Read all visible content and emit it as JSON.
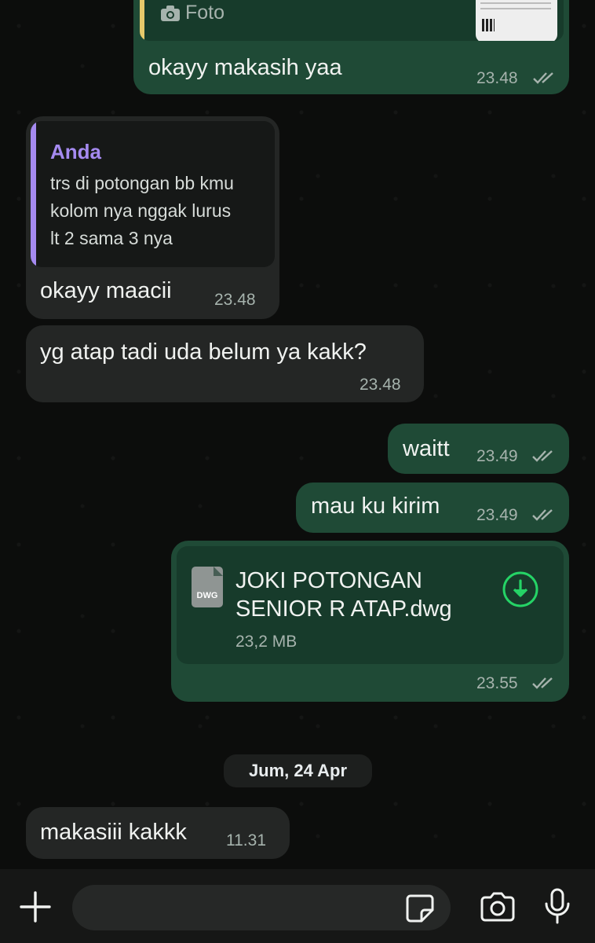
{
  "messages": {
    "m1": {
      "caption": "Foto",
      "text": "okayy makasih yaa",
      "time": "23.48"
    },
    "m2": {
      "quote_author": "Anda",
      "quote_lines": [
        "trs di potongan bb kmu",
        "kolom nya nggak lurus",
        "lt 2 sama 3 nya"
      ],
      "text": "okayy maacii",
      "time": "23.48"
    },
    "m3": {
      "text": "yg atap tadi uda belum ya kakk?",
      "time": "23.48"
    },
    "m4": {
      "text": "waitt",
      "time": "23.49"
    },
    "m5": {
      "text": "mau ku kirim",
      "time": "23.49"
    },
    "m6": {
      "file_type": "DWG",
      "file_name_lines": [
        "JOKI POTONGAN",
        "SENIOR R ATAP.dwg"
      ],
      "file_size": "23,2 MB",
      "time": "23.55"
    },
    "date_separator": "Jum, 24 Apr",
    "m7": {
      "text": "makasiii kakkk",
      "time": "11.31"
    }
  },
  "icons": {
    "attach": "plus-icon",
    "sticker": "sticker-icon",
    "camera": "camera-icon",
    "mic": "mic-icon",
    "read_receipt": "double-check-icon",
    "download": "download-icon",
    "photo": "camera-small-icon"
  },
  "colors": {
    "outgoing_bubble": "#1f4a36",
    "incoming_bubble": "#242625",
    "quote_accent": "#a58af0",
    "download_green": "#25d366",
    "background": "#0c0d0c"
  }
}
